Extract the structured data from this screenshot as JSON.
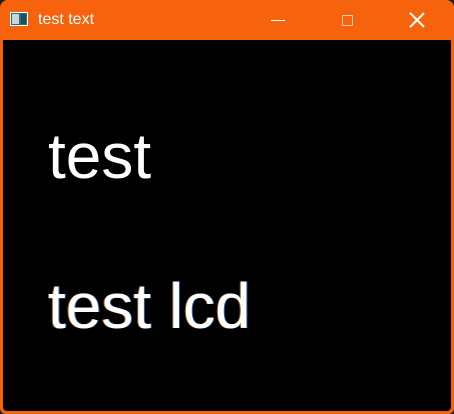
{
  "window": {
    "title": "test text",
    "accent_color": "#f7630c",
    "background_color": "#000000",
    "text_color": "#ffffff",
    "icons": {
      "app": "app-window-icon",
      "minimize": "minimize-icon",
      "maximize": "maximize-icon",
      "close": "close-icon"
    }
  },
  "content": {
    "line1": "test",
    "line2": "test lcd"
  }
}
